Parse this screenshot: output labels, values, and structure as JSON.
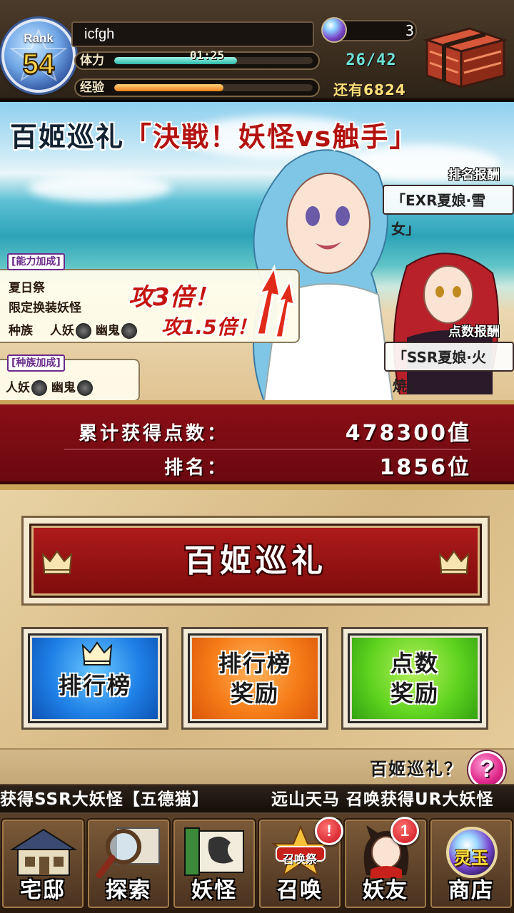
{
  "player": {
    "rank_label": "Rank",
    "rank": "54",
    "name": "icfgh",
    "stamina_label": "体力",
    "stamina_timer": "01:25",
    "stamina_count": "26/42",
    "exp_label": "经验",
    "exp_remaining": "还有6824",
    "gems": "3"
  },
  "bars": {
    "stamina_fill": 0.62,
    "exp_fill": 0.55
  },
  "event": {
    "title_prefix": "百姬巡礼",
    "title_main": "「決戦！妖怪vs触手」",
    "ranking_reward_tag": "排名报酬",
    "ranking_reward": "「EXR夏娘·雪女」",
    "points_reward_tag": "点数报酬",
    "points_reward": "「SSR夏娘·火焼」",
    "ability_buff_head": "[能力加成]",
    "ability_line1": "夏日祭",
    "ability_line2": "限定换装妖怪",
    "ability_line3_prefix": "种族",
    "race_human": "人妖",
    "race_ghost": "幽鬼",
    "race_buff_head": "[种族加成]",
    "mult_big": "攻3倍！",
    "mult_small": "攻1.5倍！"
  },
  "stats": {
    "points_label": "累计获得点数：",
    "points_value": "478300值",
    "rank_label": "排名：",
    "rank_value": "1856位"
  },
  "menu": {
    "main_button": "百姬巡礼",
    "ranking": "排行榜",
    "ranking_reward": "排行榜\n奖励",
    "points_reward": "点数\n奖励",
    "help_text": "百姬巡礼？"
  },
  "ticker": {
    "text1": "获得SSR大妖怪【五德猫】",
    "text2": "远山天马 召唤获得UR大妖怪"
  },
  "nav": [
    {
      "label": "宅邸",
      "icon": "mansion-icon",
      "badge": ""
    },
    {
      "label": "探索",
      "icon": "magnifier-icon",
      "badge": ""
    },
    {
      "label": "妖怪",
      "icon": "scroll-icon",
      "badge": ""
    },
    {
      "label": "召唤",
      "icon": "summon-star-icon",
      "badge": "!",
      "art_text": "召唤祭"
    },
    {
      "label": "妖友",
      "icon": "friend-icon",
      "badge": "1"
    },
    {
      "label": "商店",
      "icon": "spirit-jade-icon",
      "badge": "",
      "art_text": "灵玉"
    }
  ],
  "colors": {
    "stamina_bar": "#2bb9a9",
    "exp_bar": "#e87f1a",
    "stats_red": "#8a0f16",
    "btn_blue": "#1f80e6",
    "btn_orange": "#f57b17",
    "btn_green": "#5fd31f",
    "help_pink": "#e0288a"
  }
}
